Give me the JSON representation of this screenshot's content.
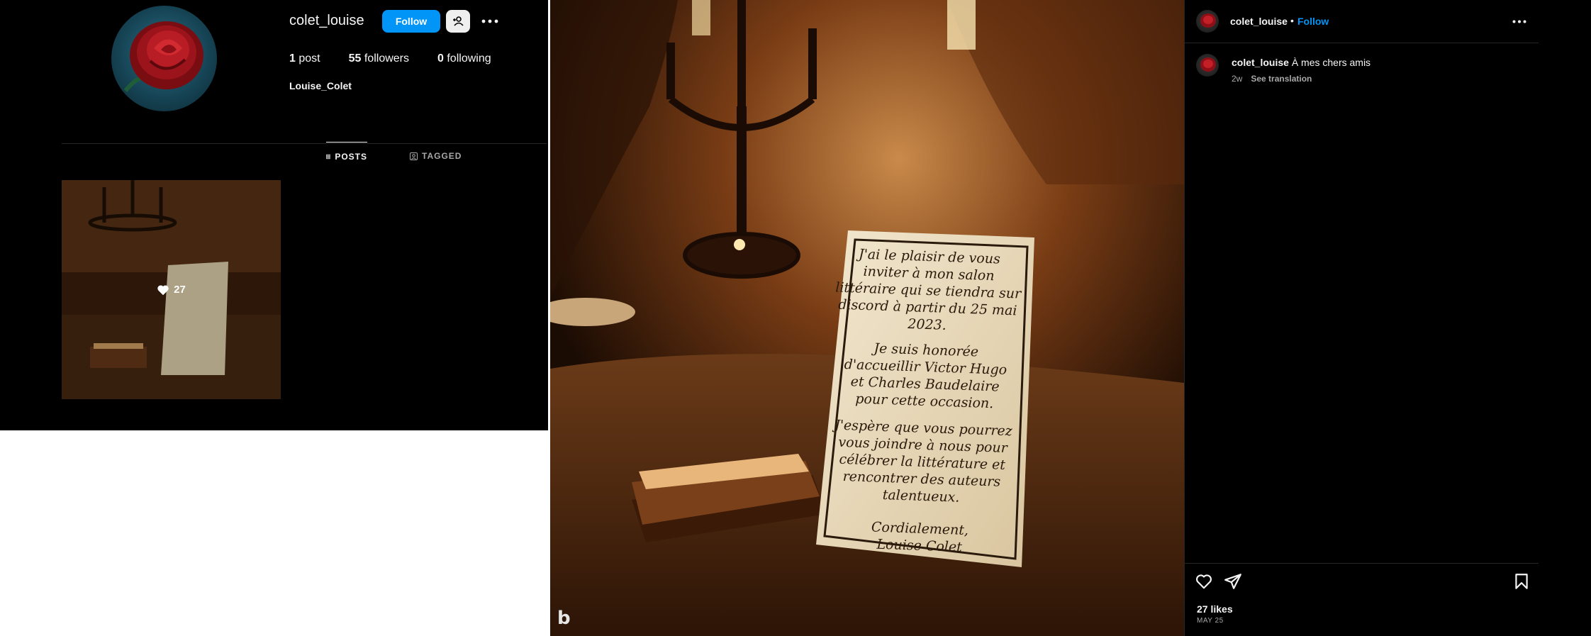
{
  "profile": {
    "username": "colet_louise",
    "follow_label": "Follow",
    "stats": {
      "posts_count": "1",
      "posts_label": "post",
      "followers_count": "55",
      "followers_label": "followers",
      "following_count": "0",
      "following_label": "following"
    },
    "full_name": "Louise_Colet",
    "tabs": [
      {
        "label": "POSTS",
        "icon": "grid-icon",
        "active": true
      },
      {
        "label": "TAGGED",
        "icon": "tag-icon",
        "active": false
      }
    ],
    "grid": [
      {
        "likes": "27"
      }
    ]
  },
  "post": {
    "card_text": [
      "J'ai le plaisir de vous",
      "inviter à mon salon",
      "littéraire qui se tiendra sur",
      "discord à partir du 25 mai",
      "2023.",
      "Je suis honorée",
      "d'accueillir Victor Hugo",
      "et Charles Baudelaire",
      "pour cette occasion.",
      "J'espère que vous pourrez",
      "vous joindre à nous pour",
      "célébrer la littérature et",
      "rencontrer des auteurs",
      "talentueux.",
      "Cordialement,",
      "Louise Colet"
    ],
    "watermark": "b"
  },
  "sidebar": {
    "username": "colet_louise",
    "separator": "•",
    "follow_label": "Follow",
    "caption_user": "colet_louise",
    "caption_text": "À mes chers amis",
    "age": "2w",
    "translate_label": "See translation",
    "likes": "27 likes",
    "date": "MAY 25"
  },
  "colors": {
    "accent": "#0095f6",
    "background": "#000000",
    "text": "#f5f5f5",
    "muted": "#a8a8a8"
  }
}
